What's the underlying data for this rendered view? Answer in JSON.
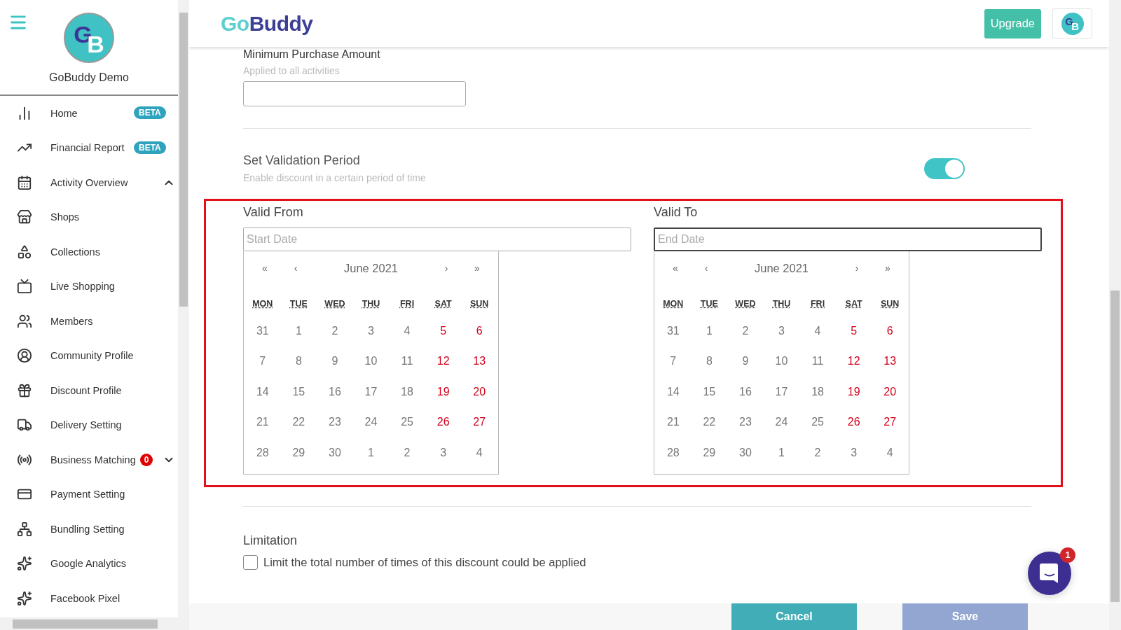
{
  "sidebar": {
    "avatar_initials": "GB",
    "account_name": "GoBuddy Demo",
    "items": [
      {
        "label": "Home",
        "badge": "BETA",
        "kind": "beta"
      },
      {
        "label": "Financial Report",
        "badge": "BETA",
        "kind": "beta"
      },
      {
        "label": "Activity Overview",
        "expanded": true
      },
      {
        "label": "Shops"
      },
      {
        "label": "Collections"
      },
      {
        "label": "Live Shopping"
      },
      {
        "label": "Members"
      },
      {
        "label": "Community Profile"
      },
      {
        "label": "Discount Profile"
      },
      {
        "label": "Delivery Setting"
      },
      {
        "label": "Business Matching",
        "badge": "0",
        "kind": "count",
        "expanded": false
      },
      {
        "label": "Payment Setting"
      },
      {
        "label": "Bundling Setting"
      },
      {
        "label": "Google Analytics"
      },
      {
        "label": "Facebook Pixel"
      }
    ]
  },
  "header": {
    "logo_parts": [
      "Go",
      "Buddy"
    ],
    "upgrade_button": "Upgrade",
    "avatar_initials": "GB"
  },
  "minimum_purchase": {
    "label": "Minimum Purchase Amount",
    "hint": "Applied to all activities"
  },
  "validation": {
    "title": "Set Validation Period",
    "hint": "Enable discount in a certain period of time",
    "on": true
  },
  "date_pickers": [
    {
      "label": "Valid From",
      "placeholder": "Start Date",
      "focused": false,
      "month": "June 2021",
      "nav": [
        "«",
        "‹",
        "›",
        "»"
      ],
      "weekdays": [
        "MON",
        "TUE",
        "WED",
        "THU",
        "FRI",
        "SAT",
        "SUN"
      ],
      "weeks": [
        [
          {
            "day": "31",
            "kind": "outside"
          },
          {
            "day": "1",
            "kind": "weekday"
          },
          {
            "day": "2",
            "kind": "weekday"
          },
          {
            "day": "3",
            "kind": "weekday"
          },
          {
            "day": "4",
            "kind": "weekday"
          },
          {
            "day": "5",
            "kind": "weekend"
          },
          {
            "day": "6",
            "kind": "weekend"
          }
        ],
        [
          {
            "day": "7",
            "kind": "weekday"
          },
          {
            "day": "8",
            "kind": "weekday"
          },
          {
            "day": "9",
            "kind": "weekday"
          },
          {
            "day": "10",
            "kind": "weekday"
          },
          {
            "day": "11",
            "kind": "weekday"
          },
          {
            "day": "12",
            "kind": "weekend"
          },
          {
            "day": "13",
            "kind": "weekend"
          }
        ],
        [
          {
            "day": "14",
            "kind": "weekday"
          },
          {
            "day": "15",
            "kind": "weekday"
          },
          {
            "day": "16",
            "kind": "weekday"
          },
          {
            "day": "17",
            "kind": "weekday"
          },
          {
            "day": "18",
            "kind": "weekday"
          },
          {
            "day": "19",
            "kind": "weekend"
          },
          {
            "day": "20",
            "kind": "weekend"
          }
        ],
        [
          {
            "day": "21",
            "kind": "weekday"
          },
          {
            "day": "22",
            "kind": "weekday"
          },
          {
            "day": "23",
            "kind": "weekday"
          },
          {
            "day": "24",
            "kind": "weekday"
          },
          {
            "day": "25",
            "kind": "weekday"
          },
          {
            "day": "26",
            "kind": "weekend"
          },
          {
            "day": "27",
            "kind": "weekend"
          }
        ],
        [
          {
            "day": "28",
            "kind": "weekday"
          },
          {
            "day": "29",
            "kind": "weekday"
          },
          {
            "day": "30",
            "kind": "weekday"
          },
          {
            "day": "1",
            "kind": "outside"
          },
          {
            "day": "2",
            "kind": "outside"
          },
          {
            "day": "3",
            "kind": "outside"
          },
          {
            "day": "4",
            "kind": "outside"
          }
        ]
      ]
    },
    {
      "label": "Valid To",
      "placeholder": "End Date",
      "focused": true,
      "month": "June 2021",
      "nav": [
        "«",
        "‹",
        "›",
        "»"
      ],
      "weekdays": [
        "MON",
        "TUE",
        "WED",
        "THU",
        "FRI",
        "SAT",
        "SUN"
      ],
      "weeks": [
        [
          {
            "day": "31",
            "kind": "outside"
          },
          {
            "day": "1",
            "kind": "weekday"
          },
          {
            "day": "2",
            "kind": "weekday"
          },
          {
            "day": "3",
            "kind": "weekday"
          },
          {
            "day": "4",
            "kind": "weekday"
          },
          {
            "day": "5",
            "kind": "weekend"
          },
          {
            "day": "6",
            "kind": "weekend"
          }
        ],
        [
          {
            "day": "7",
            "kind": "weekday"
          },
          {
            "day": "8",
            "kind": "weekday"
          },
          {
            "day": "9",
            "kind": "weekday"
          },
          {
            "day": "10",
            "kind": "weekday"
          },
          {
            "day": "11",
            "kind": "weekday"
          },
          {
            "day": "12",
            "kind": "weekend"
          },
          {
            "day": "13",
            "kind": "weekend"
          }
        ],
        [
          {
            "day": "14",
            "kind": "weekday"
          },
          {
            "day": "15",
            "kind": "weekday"
          },
          {
            "day": "16",
            "kind": "weekday"
          },
          {
            "day": "17",
            "kind": "weekday"
          },
          {
            "day": "18",
            "kind": "weekday"
          },
          {
            "day": "19",
            "kind": "weekend"
          },
          {
            "day": "20",
            "kind": "weekend"
          }
        ],
        [
          {
            "day": "21",
            "kind": "weekday"
          },
          {
            "day": "22",
            "kind": "weekday"
          },
          {
            "day": "23",
            "kind": "weekday"
          },
          {
            "day": "24",
            "kind": "weekday"
          },
          {
            "day": "25",
            "kind": "weekday"
          },
          {
            "day": "26",
            "kind": "weekend"
          },
          {
            "day": "27",
            "kind": "weekend"
          }
        ],
        [
          {
            "day": "28",
            "kind": "weekday"
          },
          {
            "day": "29",
            "kind": "weekday"
          },
          {
            "day": "30",
            "kind": "weekday"
          },
          {
            "day": "1",
            "kind": "outside"
          },
          {
            "day": "2",
            "kind": "outside"
          },
          {
            "day": "3",
            "kind": "outside"
          },
          {
            "day": "4",
            "kind": "outside"
          }
        ]
      ]
    }
  ],
  "limitation": {
    "title": "Limitation",
    "checkbox_label": "Limit the total number of times of this discount could be applied",
    "checked": false
  },
  "footer": {
    "cancel": "Cancel",
    "save": "Save"
  },
  "chat": {
    "unread": "1"
  }
}
